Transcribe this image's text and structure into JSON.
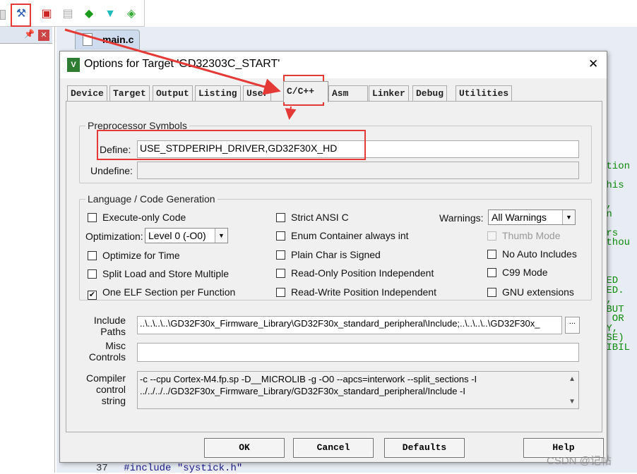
{
  "toolbar": {
    "icons": [
      "options-for-target-icon",
      "manage-components-icon",
      "batch-setup-icon",
      "select-packs-icon",
      "pack-installer-icon",
      "run-time-environment-icon"
    ]
  },
  "editor": {
    "file_tab": "main.c",
    "line_number": "37",
    "line_code": "#include \"systick.h\"",
    "code_fragments": [
      "ation",
      "",
      "this",
      "",
      "e,",
      "on",
      "",
      "ors",
      "ithou",
      "",
      ",",
      "",
      "IED",
      "MED.",
      "T,",
      " BUT",
      "  OR",
      "TY,",
      "ISE)",
      "SIBIL"
    ]
  },
  "dialog": {
    "title": "Options for Target 'GD32303C_START'",
    "close": "✕",
    "tabs": [
      "Device",
      "Target",
      "Output",
      "Listing",
      "User",
      "C/C++",
      "Asm",
      "Linker",
      "Debug",
      "Utilities"
    ],
    "active_tab": "C/C++",
    "preprocessor": {
      "legend": "Preprocessor Symbols",
      "define_label": "Define:",
      "define_value": "USE_STDPERIPH_DRIVER,GD32F30X_HD",
      "undefine_label": "Undefine:",
      "undefine_value": ""
    },
    "language": {
      "legend": "Language / Code Generation",
      "execute_only": "Execute-only Code",
      "optimization_label": "Optimization:",
      "optimization_value": "Level 0 (-O0)",
      "optimize_time": "Optimize for Time",
      "split_load": "Split Load and Store Multiple",
      "one_elf": "One ELF Section per Function",
      "strict_ansi": "Strict ANSI C",
      "enum_container": "Enum Container always int",
      "plain_char": "Plain Char is Signed",
      "ro_pi": "Read-Only Position Independent",
      "rw_pi": "Read-Write Position Independent",
      "warnings_label": "Warnings:",
      "warnings_value": "All Warnings",
      "thumb_mode": "Thumb Mode",
      "no_auto_includes": "No Auto Includes",
      "c99": "C99 Mode",
      "gnu": "GNU extensions",
      "checked": {
        "one_elf": true
      }
    },
    "include_label": [
      "Include",
      "Paths"
    ],
    "include_value": "..\\..\\..\\..\\GD32F30x_Firmware_Library\\GD32F30x_standard_peripheral\\Include;..\\..\\..\\..\\GD32F30x_",
    "browse": "...",
    "misc_label": [
      "Misc",
      "Controls"
    ],
    "misc_value": "",
    "compiler_label": [
      "Compiler",
      "control",
      "string"
    ],
    "compiler_lines": [
      "-c --cpu Cortex-M4.fp.sp -D__MICROLIB -g -O0 --apcs=interwork --split_sections -I",
      "../../../../GD32F30x_Firmware_Library/GD32F30x_standard_peripheral/Include -I"
    ],
    "buttons": {
      "ok": "OK",
      "cancel": "Cancel",
      "defaults": "Defaults",
      "help": "Help"
    }
  },
  "watermark": "CSDN @记帖",
  "colors": {
    "annotation": "#e53935",
    "code": "#0a8a0a"
  }
}
